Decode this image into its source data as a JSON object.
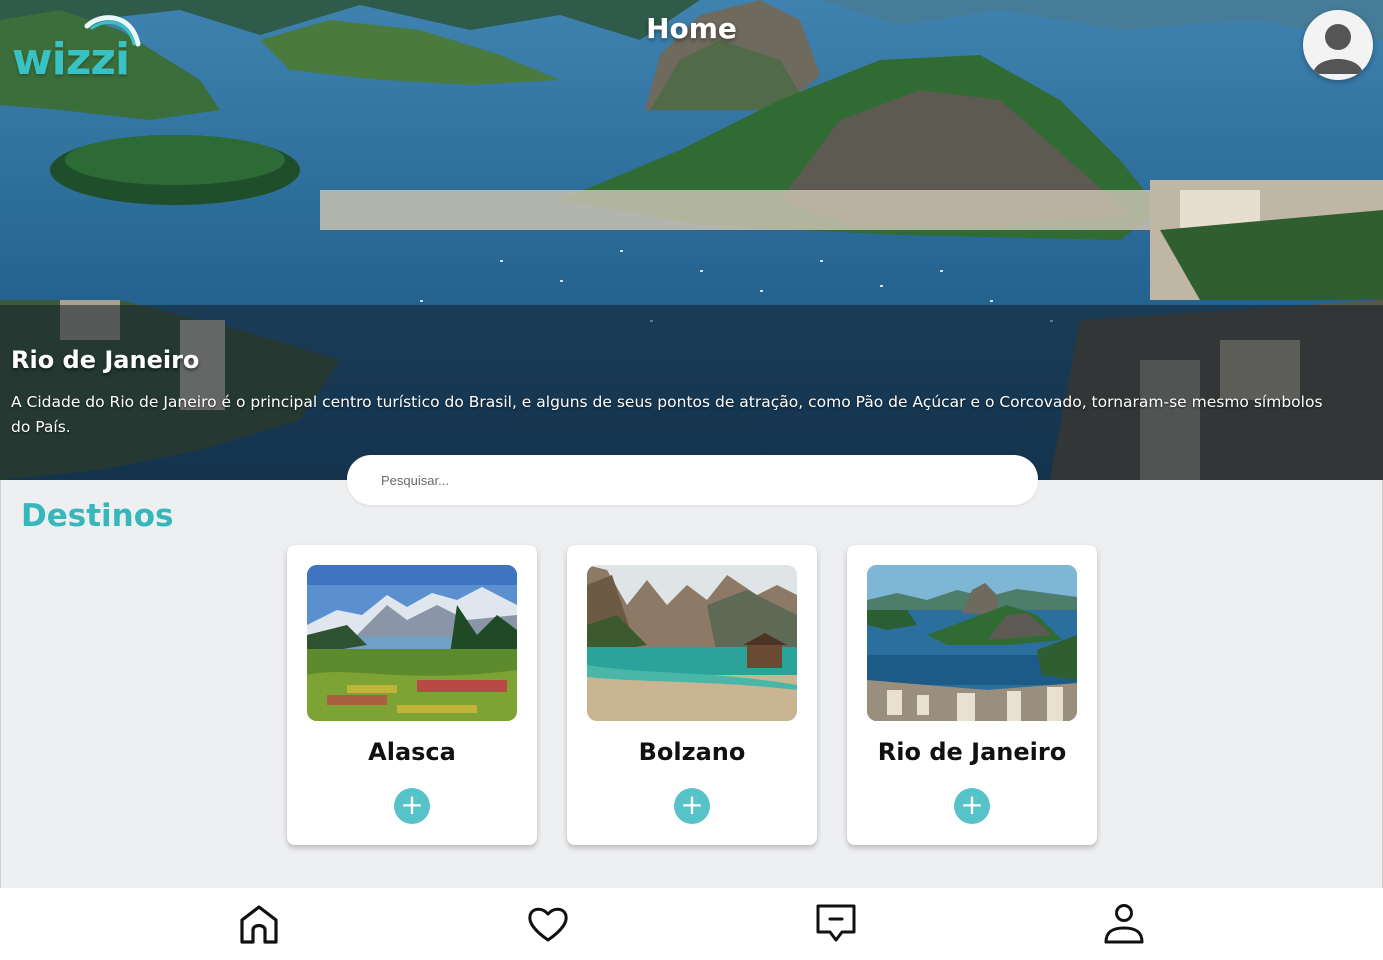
{
  "header": {
    "logo_text": "wizzi",
    "title": "Home"
  },
  "hero": {
    "title": "Rio de Janeiro",
    "description": "A Cidade do Rio de Janeiro é o principal centro turístico do Brasil, e alguns de seus pontos de atração, como Pão de Açúcar e o Corcovado, tornaram-se mesmo símbolos do País."
  },
  "search": {
    "placeholder": "Pesquisar...",
    "value": ""
  },
  "destinos": {
    "title": "Destinos",
    "cards": [
      {
        "name": "Alasca",
        "add_label": "+",
        "image": "alaska-landscape"
      },
      {
        "name": "Bolzano",
        "add_label": "+",
        "image": "bolzano-lake"
      },
      {
        "name": "Rio de Janeiro",
        "add_label": "+",
        "image": "rio-sugarloaf"
      }
    ]
  },
  "bottom_nav": {
    "items": [
      {
        "icon": "home-icon"
      },
      {
        "icon": "heart-icon"
      },
      {
        "icon": "message-icon"
      },
      {
        "icon": "user-icon"
      }
    ]
  },
  "colors": {
    "accent": "#35b7bb",
    "button": "#56c3c8",
    "background": "#eeeff1"
  }
}
